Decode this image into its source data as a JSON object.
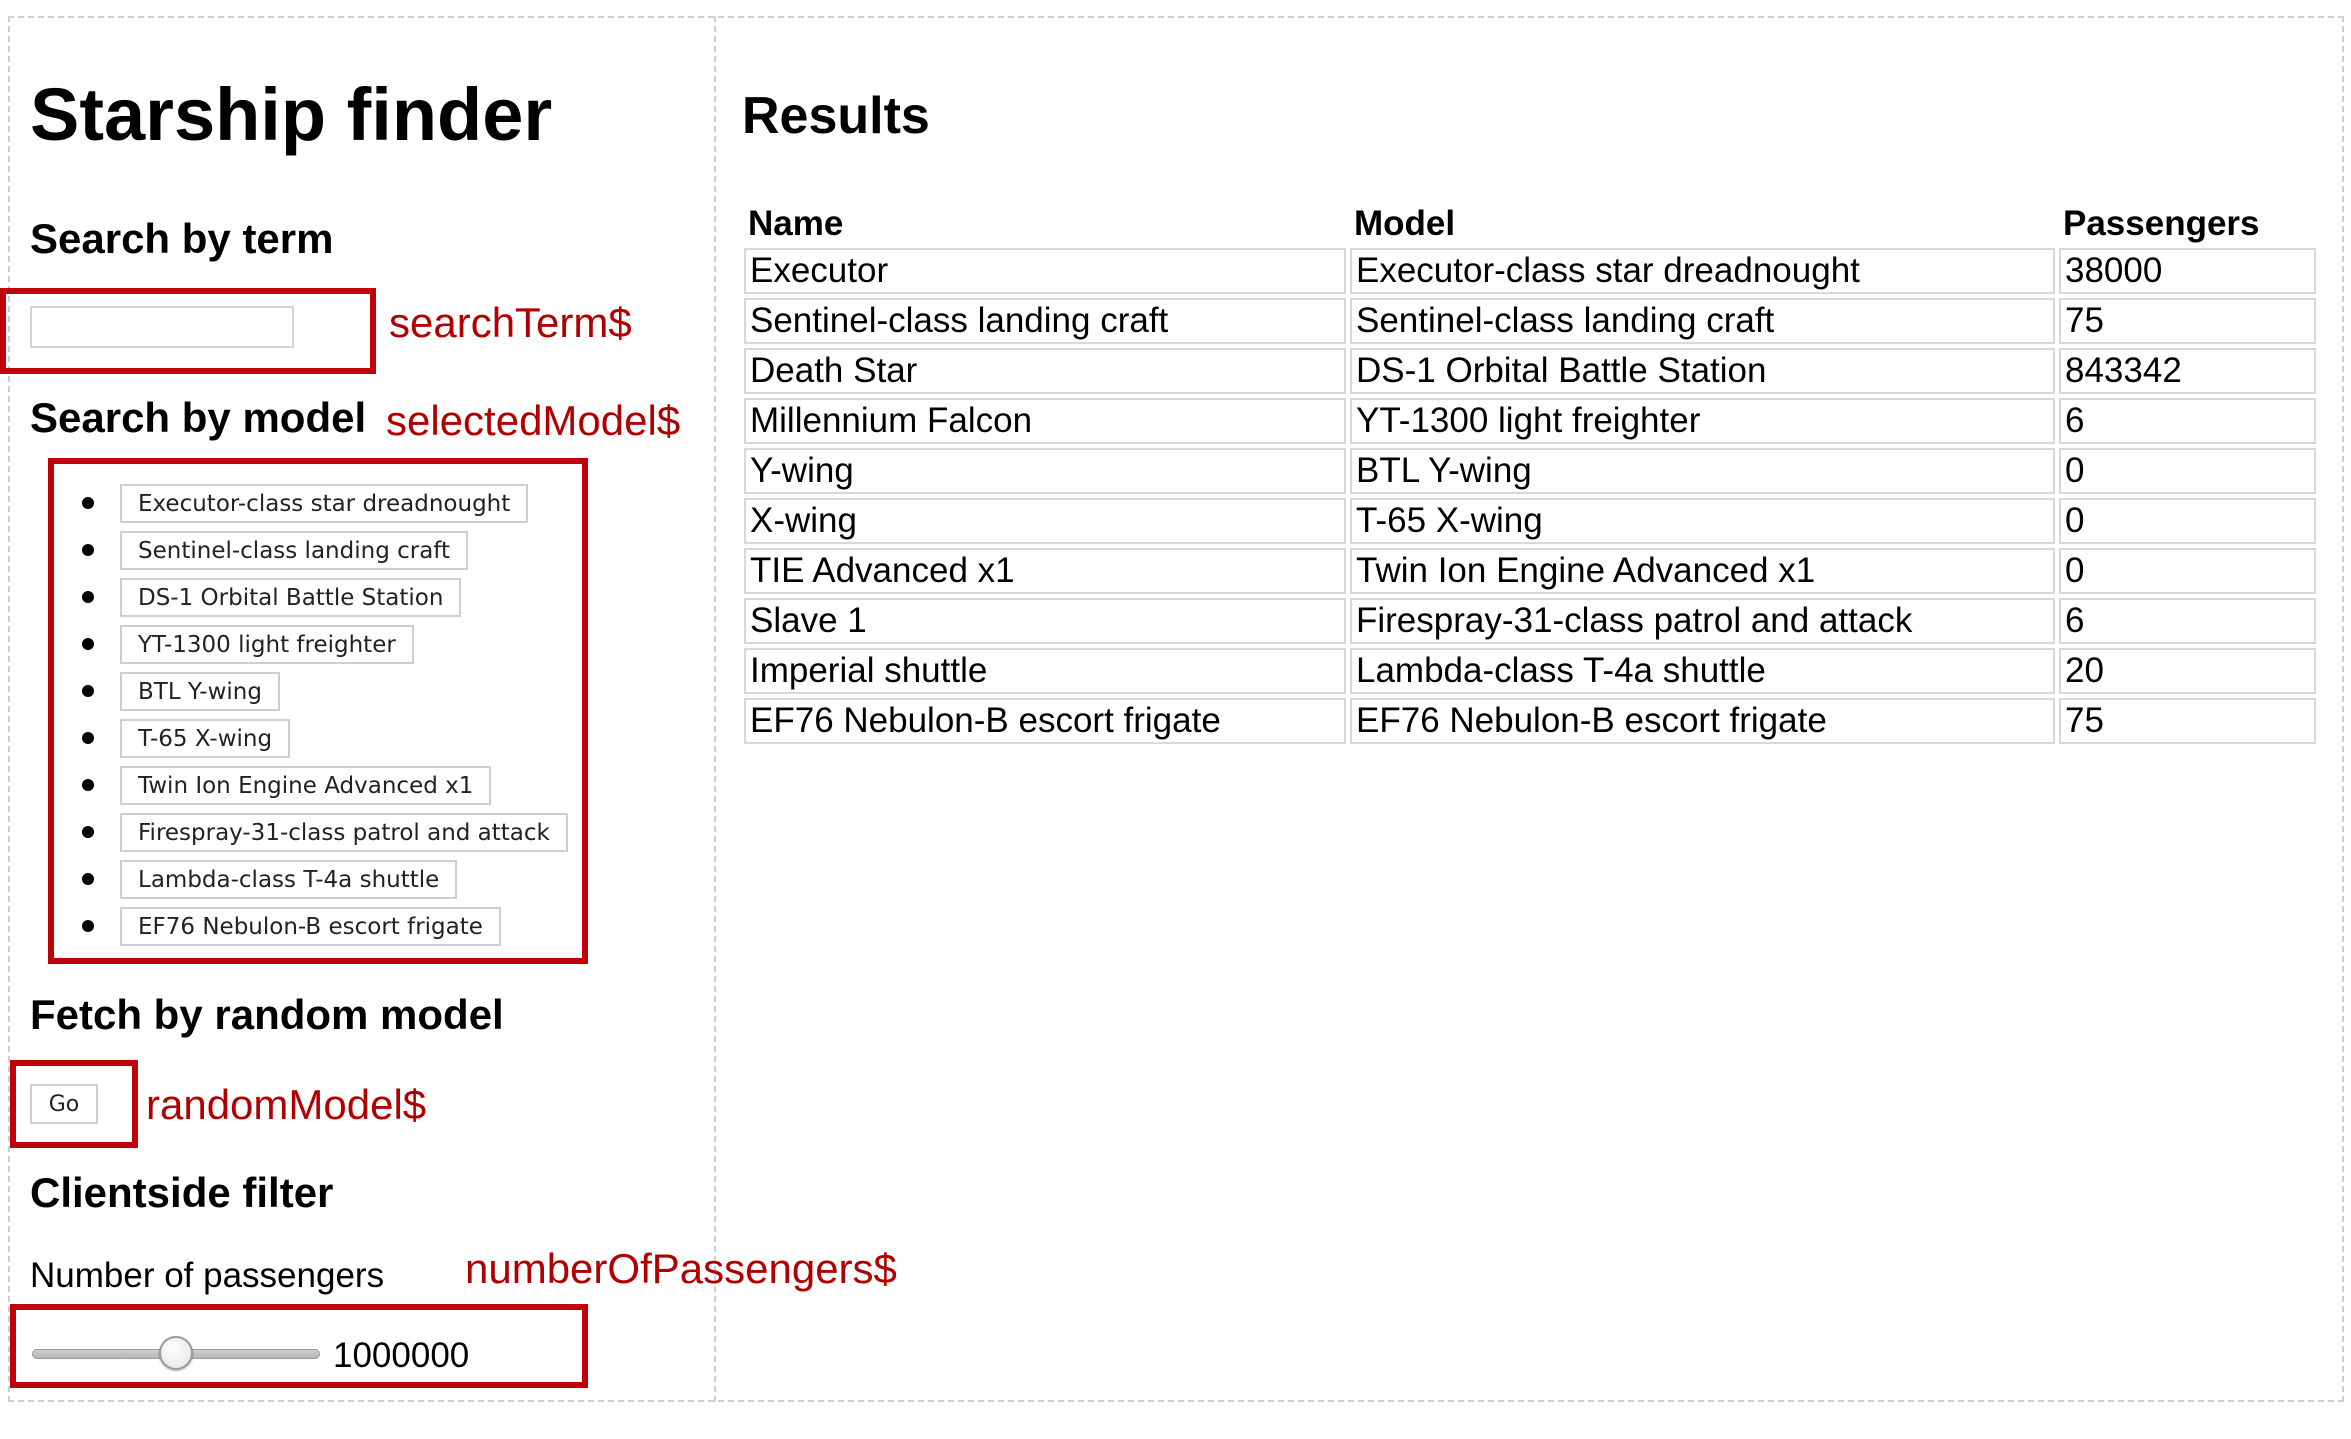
{
  "left_panel": {
    "title": "Starship finder",
    "search_term": {
      "heading": "Search by term",
      "value": "",
      "placeholder": "",
      "annotation": "searchTerm$"
    },
    "search_model": {
      "heading": "Search by model",
      "annotation": "selectedModel$",
      "models": [
        "Executor-class star dreadnought",
        "Sentinel-class landing craft",
        "DS-1 Orbital Battle Station",
        "YT-1300 light freighter",
        "BTL Y-wing",
        "T-65 X-wing",
        "Twin Ion Engine Advanced x1",
        "Firespray-31-class patrol and attack",
        "Lambda-class T-4a shuttle",
        "EF76 Nebulon-B escort frigate"
      ]
    },
    "random_model": {
      "heading": "Fetch by random model",
      "button_label": "Go",
      "annotation": "randomModel$"
    },
    "client_filter": {
      "heading": "Clientside filter",
      "label": "Number of passengers",
      "value": "1000000",
      "slider_fraction": 0.5,
      "annotation": "numberOfPassengers$"
    }
  },
  "results": {
    "title": "Results",
    "columns": [
      "Name",
      "Model",
      "Passengers"
    ],
    "rows": [
      [
        "Executor",
        "Executor-class star dreadnought",
        "38000"
      ],
      [
        "Sentinel-class landing craft",
        "Sentinel-class landing craft",
        "75"
      ],
      [
        "Death Star",
        "DS-1 Orbital Battle Station",
        "843342"
      ],
      [
        "Millennium Falcon",
        "YT-1300 light freighter",
        "6"
      ],
      [
        "Y-wing",
        "BTL Y-wing",
        "0"
      ],
      [
        "X-wing",
        "T-65 X-wing",
        "0"
      ],
      [
        "TIE Advanced x1",
        "Twin Ion Engine Advanced x1",
        "0"
      ],
      [
        "Slave 1",
        "Firespray-31-class patrol and attack",
        "6"
      ],
      [
        "Imperial shuttle",
        "Lambda-class T-4a shuttle",
        "20"
      ],
      [
        "EF76 Nebulon-B escort frigate",
        "EF76 Nebulon-B escort frigate",
        "75"
      ]
    ]
  },
  "colors": {
    "annotation": "#b00000",
    "annotation_box": "#c0000a",
    "divider": "#cfcfcf"
  }
}
